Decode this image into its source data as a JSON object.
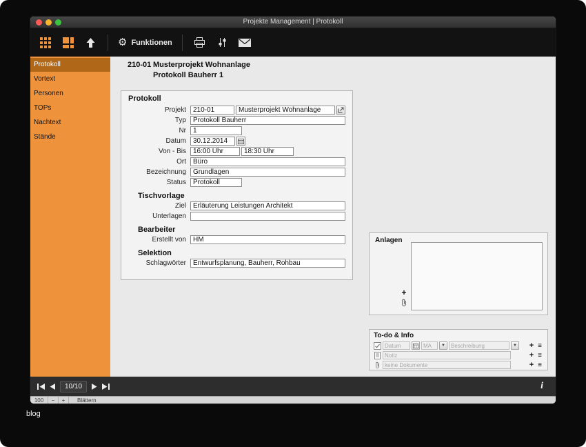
{
  "window": {
    "title": "Projekte Management | Protokoll"
  },
  "toolbar": {
    "funktionen_label": "Funktionen"
  },
  "sidebar": {
    "items": [
      {
        "label": "Protokoll"
      },
      {
        "label": "Vortext"
      },
      {
        "label": "Personen"
      },
      {
        "label": "TOPs"
      },
      {
        "label": "Nachtext"
      },
      {
        "label": "Stände"
      }
    ]
  },
  "header": {
    "code": "210-01",
    "name": "Musterprojekt Wohnanlage",
    "subtitle": "Protokoll Bauherr 1"
  },
  "form": {
    "title": "Protokoll",
    "projekt_label": "Projekt",
    "projekt_code": "210-01",
    "projekt_name": "Musterprojekt Wohnanlage",
    "typ_label": "Typ",
    "typ": "Protokoll Bauherr",
    "nr_label": "Nr",
    "nr": "1",
    "datum_label": "Datum",
    "datum": "30.12.2014",
    "vonbis_label": "Von - Bis",
    "von": "16:00 Uhr",
    "bis": "18:30 Uhr",
    "ort_label": "Ort",
    "ort": "Büro",
    "bezeichnung_label": "Bezeichnung",
    "bezeichnung": "Grundlagen",
    "status_label": "Status",
    "status": "Protokoll",
    "tischvorlage_title": "Tischvorlage",
    "ziel_label": "Ziel",
    "ziel": "Erläuterung Leistungen Architekt",
    "unterlagen_label": "Unterlagen",
    "unterlagen": "",
    "bearbeiter_title": "Bearbeiter",
    "erstellt_label": "Erstellt von",
    "erstellt": "HM",
    "selektion_title": "Selektion",
    "schlagwoerter_label": "Schlagwörter",
    "schlagwoerter": "Entwurfsplanung, Bauherr, Rohbau"
  },
  "anlagen": {
    "title": "Anlagen"
  },
  "todo": {
    "title": "To-do & Info",
    "datum_placeholder": "Datum",
    "ma_placeholder": "MA",
    "beschreibung_placeholder": "Beschreibung",
    "notiz_placeholder": "Notiz",
    "dokumente_placeholder": "keine Dokumente"
  },
  "nav": {
    "page": "10/10",
    "info_label": "i"
  },
  "zoom": {
    "level": "100",
    "mode": "Blättern"
  },
  "icons": {
    "gear": "⚙",
    "plus": "+",
    "menu": "≡",
    "dropdown": "▼",
    "zoom_out": "−",
    "zoom_in": "+"
  },
  "footer": {
    "caption": "blog"
  }
}
